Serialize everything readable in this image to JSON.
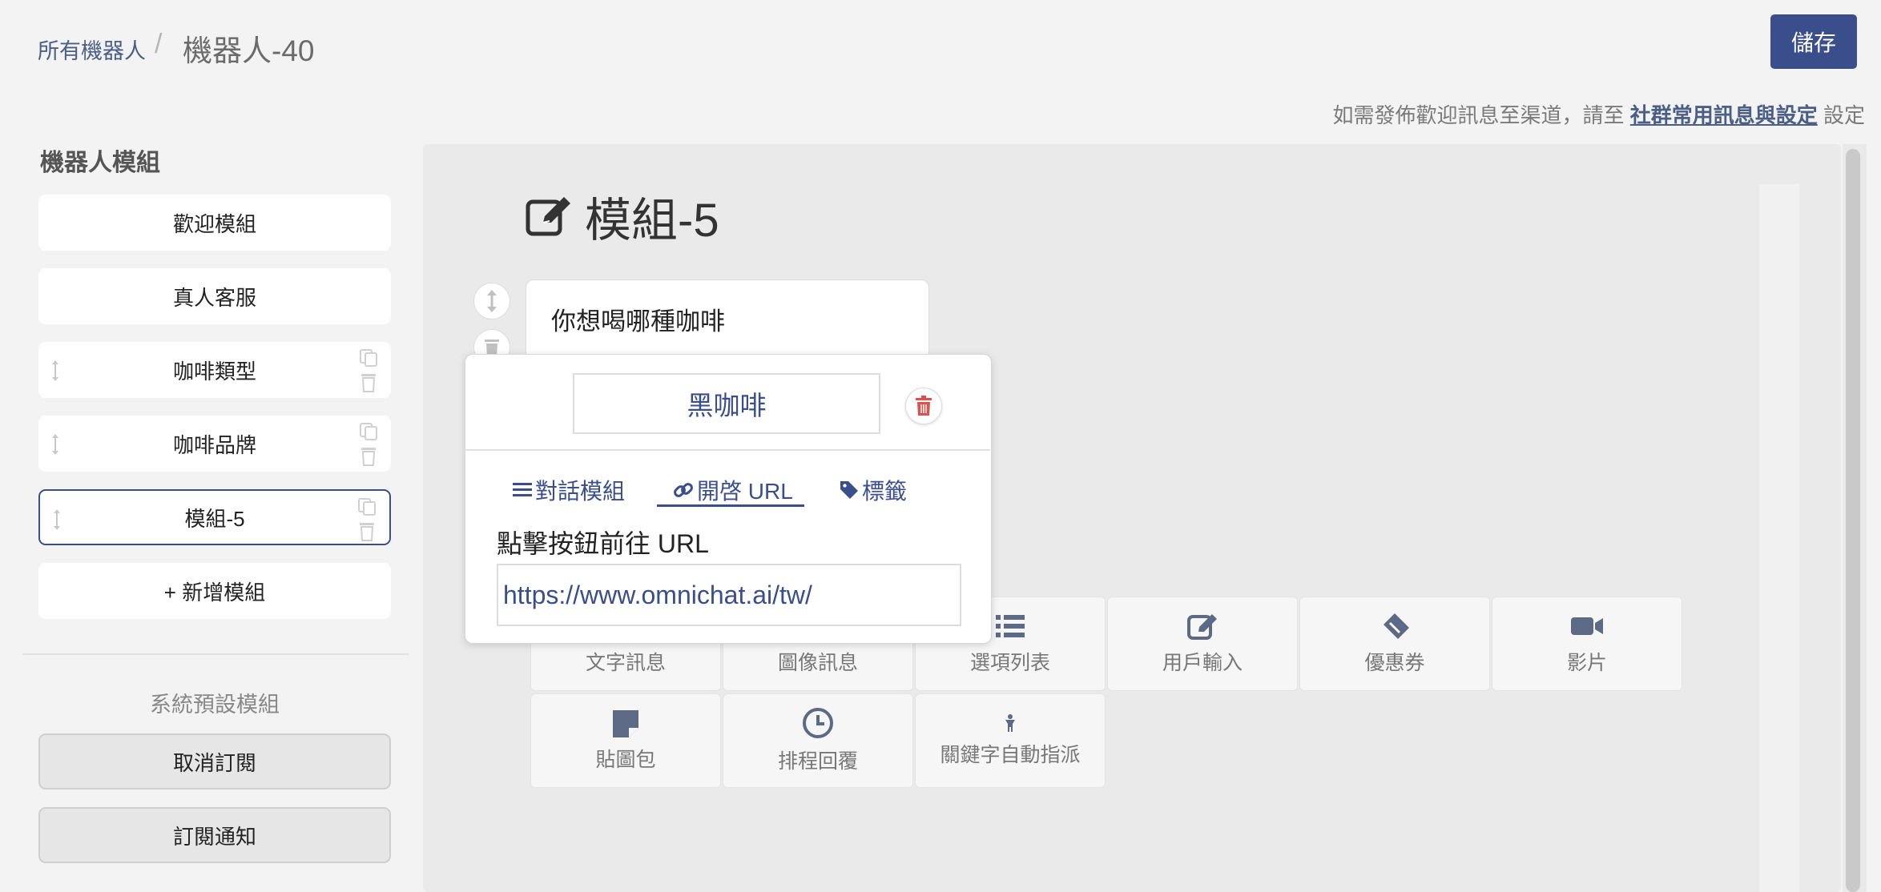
{
  "header": {
    "breadcrumb_root": "所有機器人",
    "breadcrumb_separator": "/",
    "breadcrumb_current": "機器人-40",
    "save_label": "儲存"
  },
  "hint": {
    "prefix": "如需發佈歡迎訊息至渠道，請至",
    "link": "社群常用訊息與設定",
    "suffix": "設定"
  },
  "sidebar": {
    "title": "機器人模組",
    "modules": [
      {
        "label": "歡迎模組"
      },
      {
        "label": "真人客服"
      },
      {
        "label": "咖啡類型"
      },
      {
        "label": "咖啡品牌"
      },
      {
        "label": "模組-5"
      }
    ],
    "add_label": "+ 新增模組",
    "system_title": "系統預設模組",
    "system_modules": [
      {
        "label": "取消訂閱"
      },
      {
        "label": "訂閱通知"
      }
    ]
  },
  "main": {
    "module_title": "模組-5",
    "message_text": "你想喝哪種咖啡"
  },
  "tools": [
    {
      "label": "文字訊息",
      "icon": "text-icon"
    },
    {
      "label": "圖像訊息",
      "icon": "image-icon"
    },
    {
      "label": "選項列表",
      "icon": "list-icon"
    },
    {
      "label": "用戶輸入",
      "icon": "edit-icon"
    },
    {
      "label": "優惠券",
      "icon": "ticket-icon"
    },
    {
      "label": "影片",
      "icon": "video-icon"
    },
    {
      "label": "貼圖包",
      "icon": "sticker-icon"
    },
    {
      "label": "排程回覆",
      "icon": "clock-icon"
    },
    {
      "label": "關鍵字自動指派",
      "icon": "person-icon"
    }
  ],
  "popup": {
    "button_label": "黑咖啡",
    "tabs": [
      {
        "label": "對話模組",
        "icon": "bars-icon"
      },
      {
        "label": "開啓 URL",
        "icon": "link-icon"
      },
      {
        "label": "標籤",
        "icon": "tag-icon"
      }
    ],
    "active_tab": "開啓 URL",
    "url_label": "點擊按鈕前往 URL",
    "url_value": "https://www.omnichat.ai/tw/"
  },
  "colors": {
    "primary": "#3a4e8c",
    "danger": "#d9534f",
    "icon_gray": "#5d6a86",
    "canvas": "#eaeaea"
  }
}
